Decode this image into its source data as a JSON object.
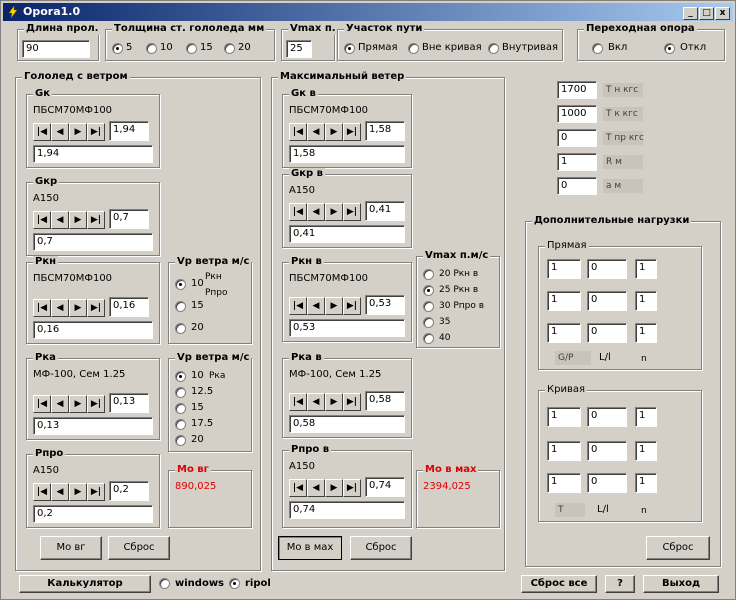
{
  "window": {
    "title": "Opora1.0",
    "min_label": "_",
    "max_label": "□",
    "close_label": "x"
  },
  "top": {
    "span_title": "Длина прол.",
    "span_value": "90",
    "thick_title": "Толщина ст. гололеда мм",
    "thick_options": [
      "5",
      "10",
      "15",
      "20"
    ],
    "vmax_title": "Vmax п.",
    "vmax_value": "25",
    "section_title": "Участок пути",
    "section_options": [
      "Прямая",
      "Вне кривая",
      "Внутривая"
    ],
    "transition_title": "Переходная опора",
    "transition_options": [
      "Вкл",
      "Откл"
    ]
  },
  "ice": {
    "title": "Гололед с ветром",
    "gk": {
      "title": "Gк",
      "wire": "ПБСМ70МФ100",
      "spin": "1,94",
      "value": "1,94"
    },
    "gkp": {
      "title": "Gкр",
      "wire": "А150",
      "spin": "0,7",
      "value": "0,7"
    },
    "pkg": {
      "title": "Ркн",
      "wire": "ПБСМ70МФ100",
      "spin": "0,16",
      "value": "0,16"
    },
    "pka": {
      "title": "Рка",
      "wire": "МФ-100, Сем 1.25",
      "spin": "0,13",
      "value": "0,13"
    },
    "ppro": {
      "title": "Рпро",
      "wire": "А150",
      "spin": "0,2",
      "value": "0,2"
    },
    "wind1": {
      "title": "Vр ветра м/с",
      "options": [
        "10",
        "15",
        "20"
      ],
      "extra1": "Ркн",
      "extra2": "Рпро"
    },
    "wind2": {
      "title": "Vр ветра м/с",
      "options": [
        "10",
        "12.5",
        "15",
        "17.5",
        "20"
      ],
      "extra": "Рка"
    },
    "mo_title": "Мо вг",
    "mo_value": "890,025",
    "btn_mo": "Мо вг",
    "btn_reset": "Сброс"
  },
  "wind": {
    "title": "Максимальный ветер",
    "gk": {
      "title": "Gк в",
      "wire": "ПБСМ70МФ100",
      "spin": "1,58",
      "value": "1,58"
    },
    "gkp": {
      "title": "Gкр в",
      "wire": "А150",
      "spin": "0,41",
      "value": "0,41"
    },
    "pkg": {
      "title": "Ркн в",
      "wire": "ПБСМ70МФ100",
      "spin": "0,53",
      "value": "0,53"
    },
    "pka": {
      "title": "Рка в",
      "wire": "МФ-100, Сем 1.25",
      "spin": "0,58",
      "value": "0,58"
    },
    "ppro": {
      "title": "Рпро в",
      "wire": "А150",
      "spin": "0,74",
      "value": "0,74"
    },
    "vmax": {
      "title": "Vmax п.м/с",
      "options": [
        "20 Ркн в",
        "25 Ркн в",
        "30 Рпро в",
        "35",
        "40"
      ]
    },
    "mo_title": "Мо в мах",
    "mo_value": "2394,025",
    "btn_mo": "Мо в мах",
    "btn_reset": "Сброс"
  },
  "params": [
    {
      "value": "1700",
      "label": "Т н кгс"
    },
    {
      "value": "1000",
      "label": "Т к кгс"
    },
    {
      "value": "0",
      "label": "Т пр кгс"
    },
    {
      "value": "1",
      "label": "R м"
    },
    {
      "value": "0",
      "label": "а м"
    }
  ],
  "extra": {
    "title": "Дополнительные нагрузки",
    "straight_title": "Прямая",
    "straight_rows": [
      [
        "1",
        "0",
        "1"
      ],
      [
        "1",
        "0",
        "1"
      ],
      [
        "1",
        "0",
        "1"
      ]
    ],
    "straight_labels": [
      "G/P",
      "L/l",
      "n"
    ],
    "curve_title": "Кривая",
    "curve_rows": [
      [
        "1",
        "0",
        "1"
      ],
      [
        "1",
        "0",
        "1"
      ],
      [
        "1",
        "0",
        "1"
      ]
    ],
    "curve_labels": [
      "T",
      "L/l",
      "n"
    ],
    "reset": "Сброс"
  },
  "bottom": {
    "calc": "Калькулятор",
    "opt1": "windows",
    "opt2": "ripol",
    "reset_all": "Сброс все",
    "help": "?",
    "exit": "Выход"
  }
}
